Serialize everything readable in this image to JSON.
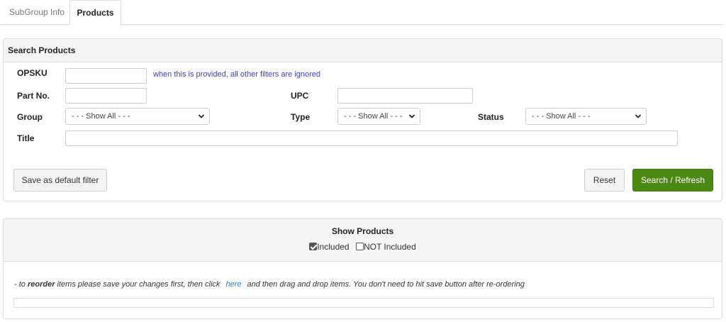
{
  "tabs": [
    {
      "label": "SubGroup Info",
      "active": false
    },
    {
      "label": "Products",
      "active": true
    }
  ],
  "search_panel": {
    "title": "Search Products",
    "opsku": {
      "label": "OPSKU",
      "value": "",
      "hint": "when this is provided, all other filters are ignored"
    },
    "part_no": {
      "label": "Part No.",
      "value": ""
    },
    "upc": {
      "label": "UPC",
      "value": ""
    },
    "group": {
      "label": "Group",
      "selected": "- - - Show All - - -"
    },
    "type": {
      "label": "Type",
      "selected": "- - - Show All - - -"
    },
    "status": {
      "label": "Status",
      "selected": "- - - Show All - - -"
    },
    "title_field": {
      "label": "Title",
      "value": ""
    },
    "buttons": {
      "save_default": "Save as default filter",
      "reset": "Reset",
      "search_refresh": "Search / Refresh"
    }
  },
  "show_panel": {
    "title": "Show Products",
    "options": [
      {
        "label": "Included",
        "checked": true
      },
      {
        "label": "NOT Included",
        "checked": false
      }
    ],
    "reorder": {
      "prefix": "- to ",
      "bold": "reorder",
      "middle": " items please save your changes first, then click",
      "link": "here",
      "suffix": "and then drag and drop items. You don't need to hit save button after re-ordering"
    }
  },
  "colors": {
    "accent_green": "#4a8a12",
    "hint_blue": "#3b3bd6",
    "link_blue": "#2a7ed2"
  },
  "icons": {
    "select_arrow": "chevron-down-icon",
    "checkbox": "checkbox-icon"
  }
}
